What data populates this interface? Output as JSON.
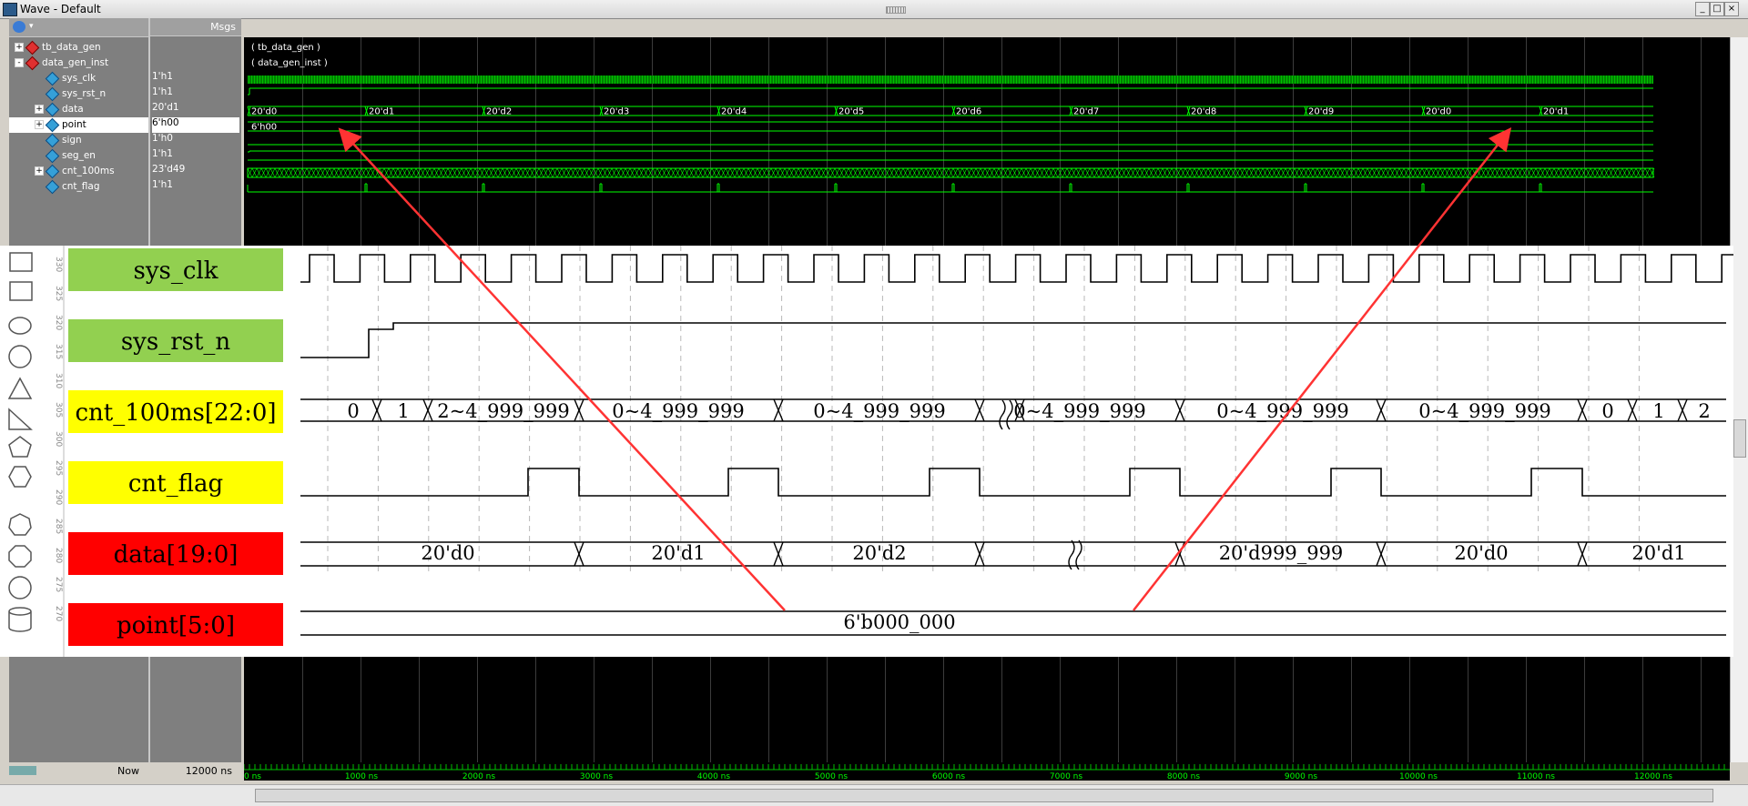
{
  "window": {
    "title": "Wave - Default"
  },
  "headers": {
    "msgs": "Msgs"
  },
  "signals": [
    {
      "name": "tb_data_gen",
      "value": "",
      "level": 0,
      "kind": "instance",
      "expander": "+"
    },
    {
      "name": "data_gen_inst",
      "value": "",
      "level": 0,
      "kind": "instance",
      "expander": "-"
    },
    {
      "name": "sys_clk",
      "value": "1'h1",
      "level": 2,
      "kind": "signal",
      "expander": ""
    },
    {
      "name": "sys_rst_n",
      "value": "1'h1",
      "level": 2,
      "kind": "signal",
      "expander": ""
    },
    {
      "name": "data",
      "value": "20'd1",
      "level": 2,
      "kind": "signal",
      "expander": "+"
    },
    {
      "name": "point",
      "value": "6'h00",
      "level": 2,
      "kind": "signal",
      "expander": "+"
    },
    {
      "name": "sign",
      "value": "1'h0",
      "level": 2,
      "kind": "signal",
      "expander": ""
    },
    {
      "name": "seg_en",
      "value": "1'h1",
      "level": 2,
      "kind": "signal",
      "expander": ""
    },
    {
      "name": "cnt_100ms",
      "value": "23'd49",
      "level": 2,
      "kind": "signal",
      "expander": "+"
    },
    {
      "name": "cnt_flag",
      "value": "1'h1",
      "level": 2,
      "kind": "signal",
      "expander": ""
    }
  ],
  "wave_labels": {
    "tb_data_gen": "( tb_data_gen )",
    "data_gen_inst": "( data_gen_inst )",
    "data_values": [
      "20'd0",
      "20'd1",
      "20'd2",
      "20'd3",
      "20'd4",
      "20'd5",
      "20'd6",
      "20'd7",
      "20'd8",
      "20'd9",
      "20'd0",
      "20'd1"
    ],
    "point_value": "6'h00"
  },
  "overlay": {
    "rows": [
      {
        "label": "sys_clk",
        "color": "#92d050"
      },
      {
        "label": "sys_rst_n",
        "color": "#92d050"
      },
      {
        "label": "cnt_100ms[22:0]",
        "color": "#ffff00"
      },
      {
        "label": "cnt_flag",
        "color": "#ffff00"
      },
      {
        "label": "data[19:0]",
        "color": "#ff0000"
      },
      {
        "label": "point[5:0]",
        "color": "#ff0000"
      }
    ],
    "cnt_values": [
      "0",
      "1",
      "2~4_999_999",
      "0~4_999_999",
      "0~4_999_999",
      "0~4_999_999",
      "0~4_999_999",
      "0~4_999_999",
      "0",
      "1",
      "2"
    ],
    "data_values": [
      "20'd0",
      "20'd1",
      "20'd2",
      "20'd999_999",
      "20'd0",
      "20'd1"
    ],
    "point_value": "6'b000_000",
    "ruler": [
      "330",
      "325",
      "320",
      "315",
      "310",
      "305",
      "300",
      "295",
      "290",
      "285",
      "280",
      "275",
      "270"
    ]
  },
  "footer": {
    "now_label": "Now",
    "now_value": "12000 ns"
  },
  "timeline": [
    "0 ns",
    "1000 ns",
    "2000 ns",
    "3000 ns",
    "4000 ns",
    "5000 ns",
    "6000 ns",
    "7000 ns",
    "8000 ns",
    "9000 ns",
    "10000 ns",
    "11000 ns",
    "12000 ns"
  ],
  "colors": {
    "wave": "#00ff00",
    "arrow": "#ff3333",
    "panel": "#7f7f7f"
  }
}
